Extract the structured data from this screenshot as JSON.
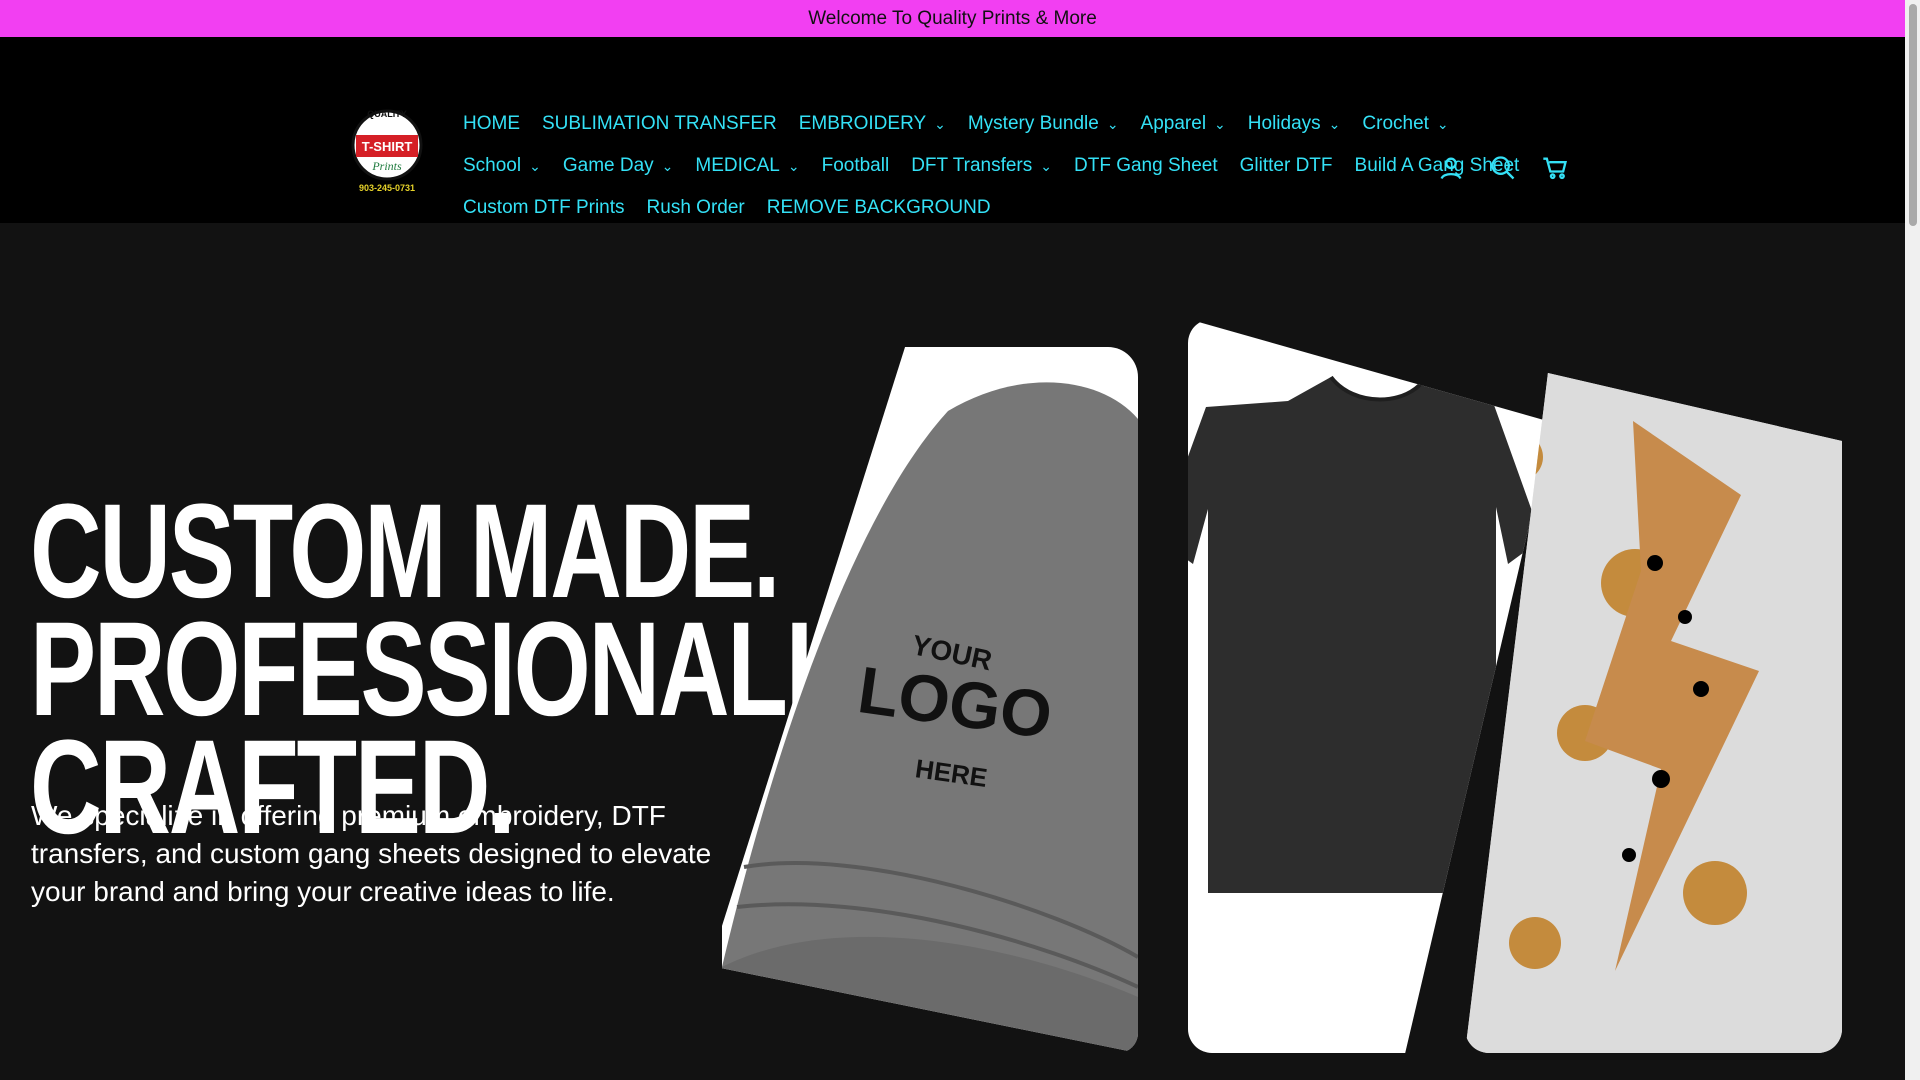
{
  "announcement": "Welcome To Quality Prints & More",
  "logo": {
    "top": "QUALITY",
    "middle": "T-SHIRT",
    "script": "Prints",
    "phone": "903-245-0731"
  },
  "nav": {
    "row1": [
      {
        "label": "HOME",
        "dropdown": false
      },
      {
        "label": "SUBLIMATION TRANSFER",
        "dropdown": false
      },
      {
        "label": "EMBROIDERY",
        "dropdown": true
      },
      {
        "label": "Mystery Bundle",
        "dropdown": true
      },
      {
        "label": "Apparel",
        "dropdown": true
      },
      {
        "label": "Holidays",
        "dropdown": true
      },
      {
        "label": "Crochet",
        "dropdown": true
      }
    ],
    "row2": [
      {
        "label": "School",
        "dropdown": true
      },
      {
        "label": "Game Day",
        "dropdown": true
      },
      {
        "label": "MEDICAL",
        "dropdown": true
      },
      {
        "label": "Football",
        "dropdown": false
      },
      {
        "label": "DFT Transfers",
        "dropdown": true
      },
      {
        "label": "DTF Gang Sheet",
        "dropdown": false
      },
      {
        "label": "Glitter DTF",
        "dropdown": false
      },
      {
        "label": "Build A Gang Sheet",
        "dropdown": false
      }
    ],
    "row3": [
      {
        "label": "Custom DTF Prints",
        "dropdown": false
      },
      {
        "label": "Rush Order",
        "dropdown": false
      },
      {
        "label": "REMOVE BACKGROUND",
        "dropdown": false
      }
    ]
  },
  "icons": [
    "account-icon",
    "search-icon",
    "cart-icon"
  ],
  "hero": {
    "headline": [
      "CUSTOM MADE.",
      "PROFESSIONALLY",
      "CRAFTED."
    ],
    "subtext": "We specialize in offering premium embroidery, DTF transfers, and custom gang sheets designed to elevate your brand and bring your creative ideas to life.",
    "cap_text": {
      "top": "YOUR",
      "middle": "LOGO",
      "bottom": "HERE"
    }
  },
  "colors": {
    "announcement_bg": "#f23ff2",
    "nav_link": "#34e1f6",
    "header_bg": "#000000",
    "hero_bg": "#121212"
  }
}
